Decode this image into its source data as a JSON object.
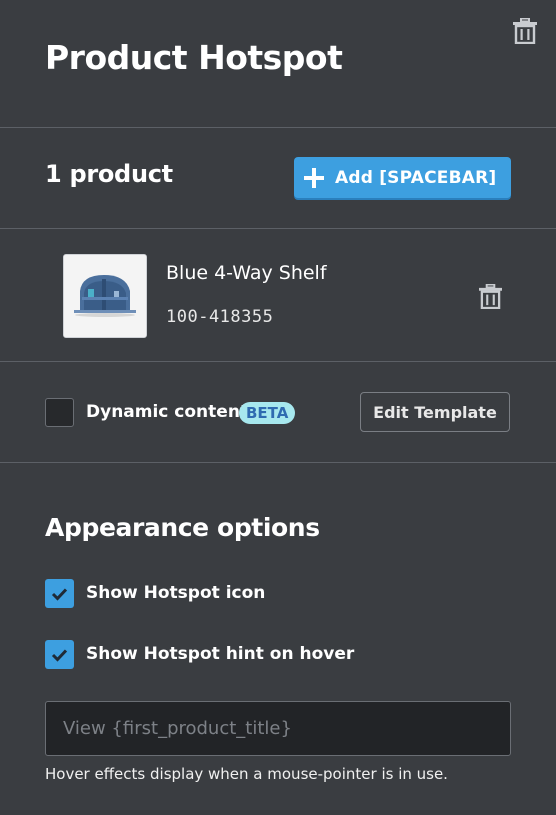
{
  "header": {
    "title": "Product Hotspot",
    "delete_icon": "trash-icon"
  },
  "products": {
    "count_label": "1 product",
    "add_button_label": "Add [SPACEBAR]",
    "add_icon": "plus-icon",
    "items": [
      {
        "name": "Blue 4-Way Shelf",
        "sku": "100-418355",
        "remove_icon": "trash-icon"
      }
    ]
  },
  "dynamic_content": {
    "label": "Dynamic content",
    "badge": "BETA",
    "checked": false,
    "edit_template_label": "Edit Template"
  },
  "appearance": {
    "title": "Appearance options",
    "show_icon_label": "Show Hotspot icon",
    "show_icon_checked": true,
    "show_hint_label": "Show Hotspot hint on hover",
    "show_hint_checked": true,
    "hint_input_value": "",
    "hint_input_placeholder": "View {first_product_title}",
    "hover_note": "Hover effects display when a mouse-pointer is in use."
  },
  "colors": {
    "background": "#3a3d41",
    "accent": "#3d9fe0",
    "beta_badge_bg": "#a7e8ee",
    "beta_badge_text": "#2f6bb0"
  }
}
